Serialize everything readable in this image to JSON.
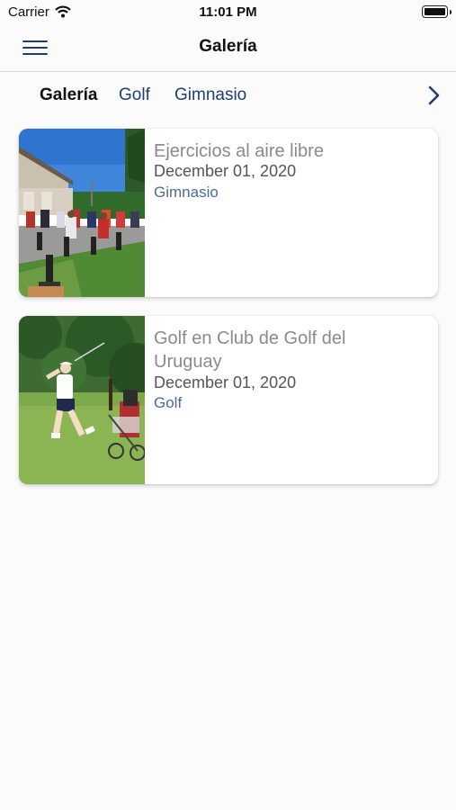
{
  "status_bar": {
    "carrier": "Carrier",
    "time": "11:01 PM"
  },
  "nav": {
    "title": "Galería",
    "menu_icon": "hamburger-menu-icon"
  },
  "tabs": [
    {
      "label": "Galería",
      "active": true
    },
    {
      "label": "Golf",
      "active": false
    },
    {
      "label": "Gimnasio",
      "active": false
    }
  ],
  "tabs_more_icon": "chevron-right-icon",
  "gallery": [
    {
      "title": "Ejercicios al aire libre",
      "date": "December 01, 2020",
      "category": "Gimnasio",
      "image": "outdoor-spin-class-photo"
    },
    {
      "title": "Golf en Club de Golf del Uruguay",
      "date": "December 01, 2020",
      "category": "Golf",
      "image": "golfer-swing-photo"
    }
  ],
  "colors": {
    "accent": "#1e3f70",
    "category": "#4f6a93",
    "title_gray": "#8a8a8a",
    "background": "#fbfbfb"
  }
}
